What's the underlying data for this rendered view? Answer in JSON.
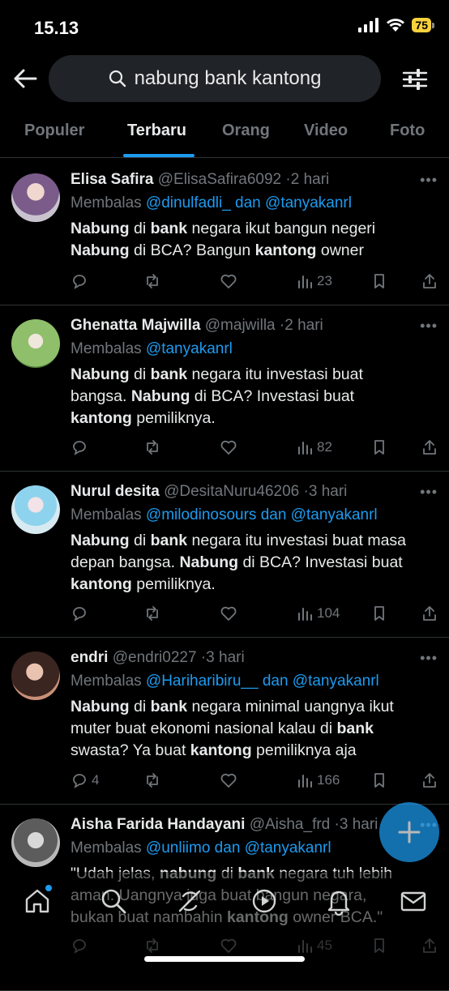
{
  "status_bar": {
    "time": "15.13",
    "battery": "75"
  },
  "search": {
    "query": "nabung bank kantong"
  },
  "tabs": [
    {
      "label": "Populer"
    },
    {
      "label": "Terbaru"
    },
    {
      "label": "Orang"
    },
    {
      "label": "Video"
    },
    {
      "label": "Foto"
    }
  ],
  "active_tab": "Terbaru",
  "colors": {
    "accent": "#1d9bf0",
    "background": "#000000",
    "muted": "#71767b"
  },
  "tweets": [
    {
      "name": "Elisa Safira",
      "handle": "@ElisaSafira6092",
      "time": "2 hari",
      "reply_prefix": "Membalas ",
      "reply_mentions": "@dinulfadli_ dan @tanyakanrl",
      "text_html": "<b>Nabung</b> di <b>bank</b> negara ikut bangun negeri<br><b>Nabung</b> di BCA? Bangun <b>kantong</b> owner",
      "replies": "",
      "views": "23"
    },
    {
      "name": "Ghenatta Majwilla",
      "handle": "@majwilla",
      "time": "2 hari",
      "reply_prefix": "Membalas ",
      "reply_mentions": "@tanyakanrl",
      "text_html": "<b>Nabung</b> di <b>bank</b> negara itu investasi buat<br>bangsa. <b>Nabung</b> di BCA? Investasi buat<br><b>kantong</b> pemiliknya.",
      "replies": "",
      "views": "82"
    },
    {
      "name": "Nurul desita",
      "handle": "@DesitaNuru46206",
      "time": "3 hari",
      "reply_prefix": "Membalas ",
      "reply_mentions": "@milodinosours dan @tanyakanrl",
      "text_html": "<b>Nabung</b> di <b>bank</b> negara itu investasi buat masa<br>depan bangsa. <b>Nabung</b> di BCA? Investasi buat<br><b>kantong</b> pemiliknya.",
      "replies": "",
      "views": "104"
    },
    {
      "name": "endri",
      "handle": "@endri0227",
      "time": "3 hari",
      "reply_prefix": "Membalas ",
      "reply_mentions": "@Hariharibiru__ dan @tanyakanrl",
      "text_html": "<b>Nabung</b> di <b>bank</b> negara minimal uangnya ikut<br>muter buat ekonomi nasional kalau di <b>bank</b><br>swasta? Ya buat <b>kantong</b> pemiliknya aja",
      "replies": "4",
      "views": "166"
    },
    {
      "name": "Aisha Farida Handayani",
      "handle": "@Aisha_frd",
      "time": "3 hari",
      "reply_prefix": "Membalas ",
      "reply_mentions": "@unliimo dan @tanyakanrl",
      "text_html": "\"Udah jelas, <b>nabung</b> di <b>bank</b> negara tuh lebih<br>aman. Uangnya juga buat bangun negara,<br>bukan buat nambahin <b>kantong</b> owner BCA.\"",
      "replies": "",
      "views": "45"
    }
  ]
}
